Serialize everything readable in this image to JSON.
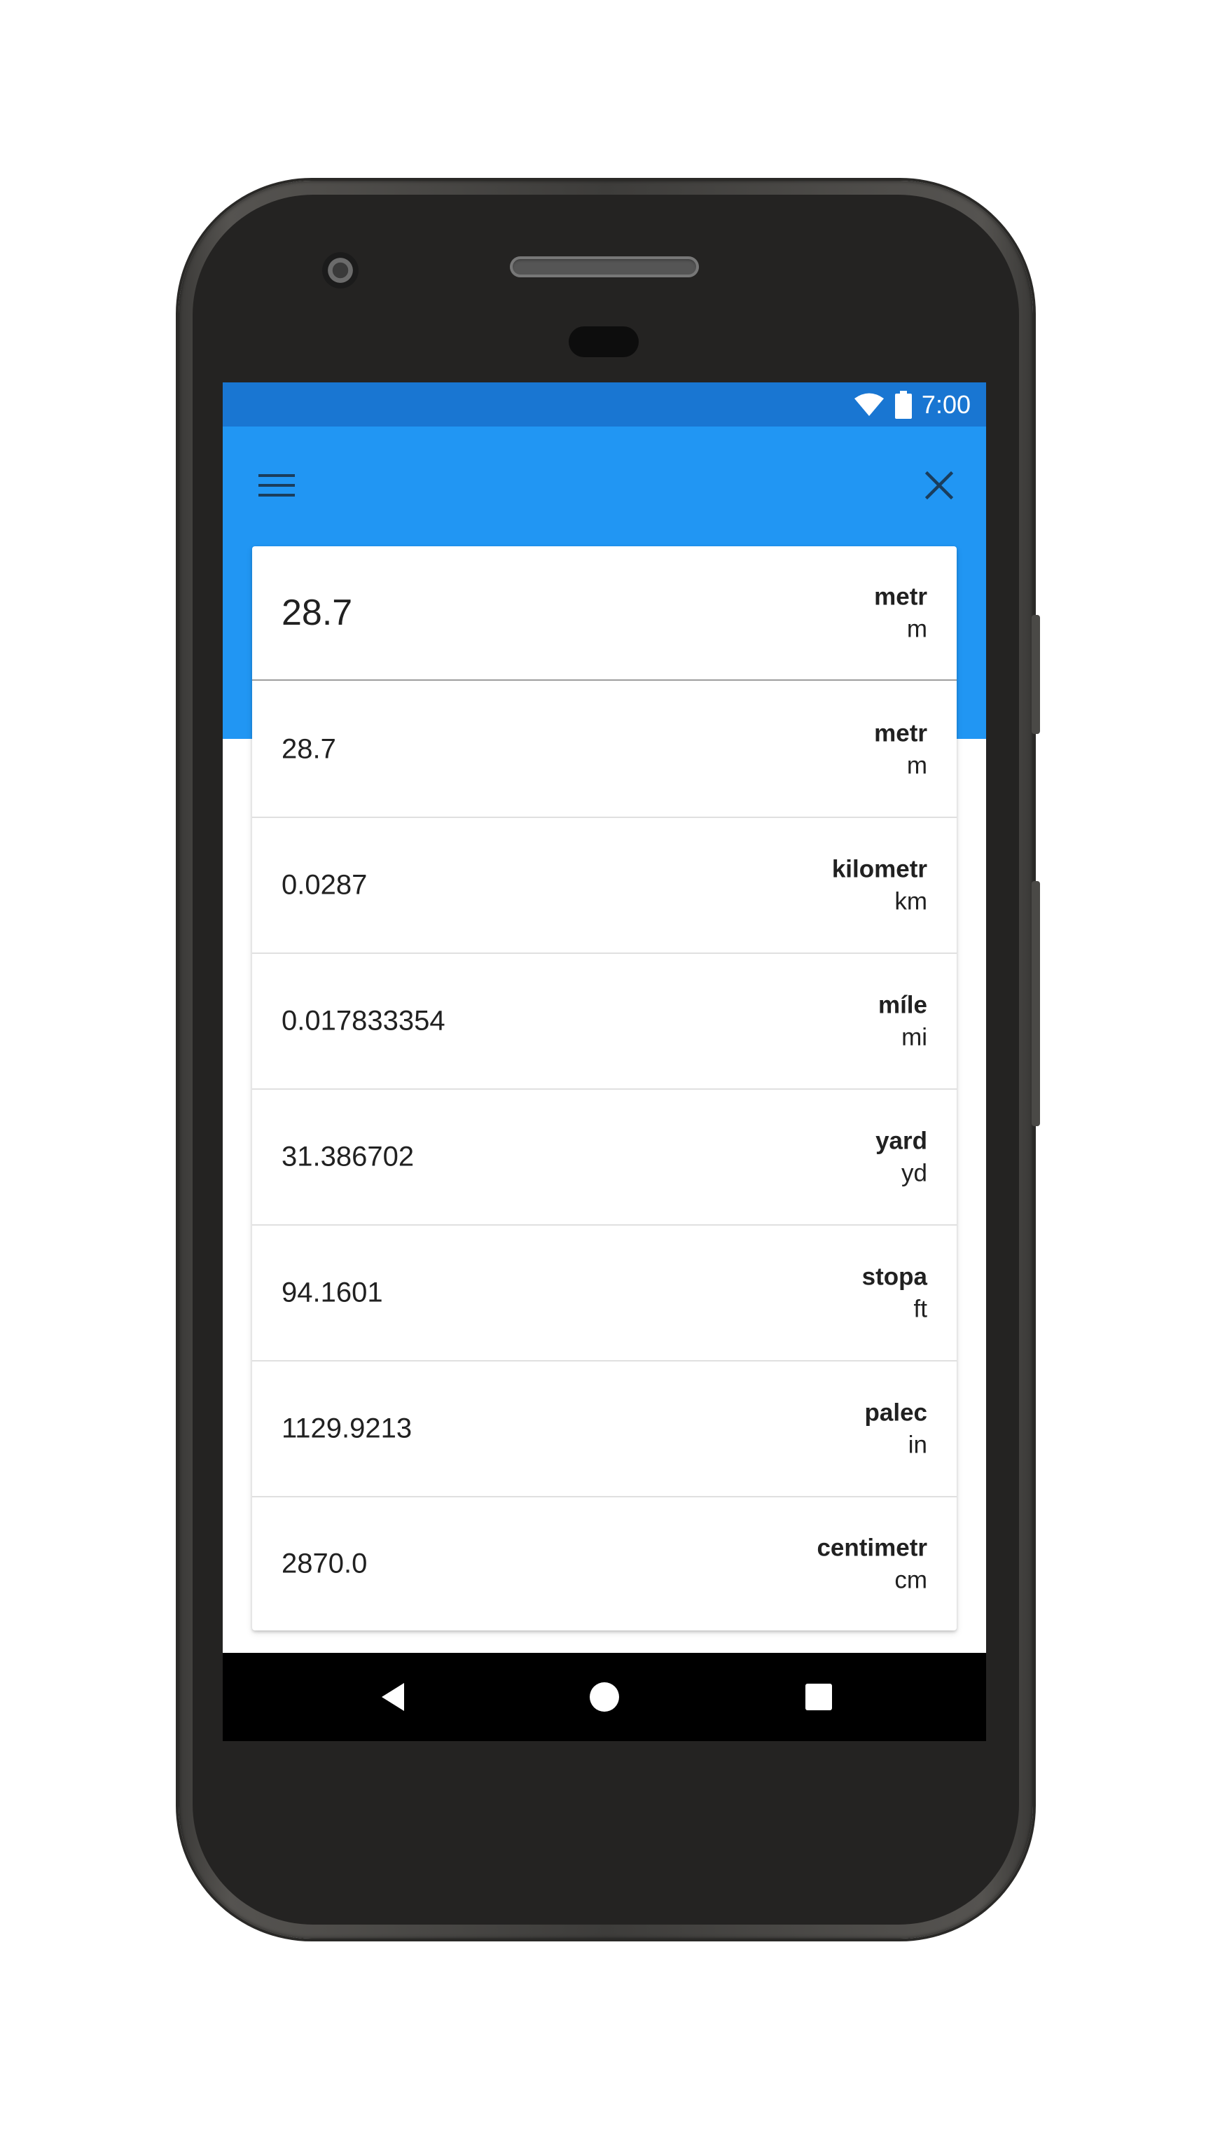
{
  "status_bar": {
    "time": "7:00",
    "icons": [
      "wifi-icon",
      "battery-icon"
    ]
  },
  "app_bar": {
    "menu_icon": "menu-icon",
    "close_icon": "close-icon",
    "background_color": "#2196f3",
    "status_color": "#1976d2"
  },
  "input": {
    "value": "28.7",
    "unit_name": "metr",
    "unit_symbol": "m"
  },
  "results": [
    {
      "value": "28.7",
      "unit_name": "metr",
      "unit_symbol": "m"
    },
    {
      "value": "0.0287",
      "unit_name": "kilometr",
      "unit_symbol": "km"
    },
    {
      "value": "0.017833354",
      "unit_name": "míle",
      "unit_symbol": "mi"
    },
    {
      "value": "31.386702",
      "unit_name": "yard",
      "unit_symbol": "yd"
    },
    {
      "value": "94.1601",
      "unit_name": "stopa",
      "unit_symbol": "ft"
    },
    {
      "value": "1129.9213",
      "unit_name": "palec",
      "unit_symbol": "in"
    },
    {
      "value": "2870.0",
      "unit_name": "centimetr",
      "unit_symbol": "cm"
    }
  ],
  "nav_bar": {
    "icons": [
      "back-icon",
      "home-icon",
      "recents-icon"
    ]
  }
}
